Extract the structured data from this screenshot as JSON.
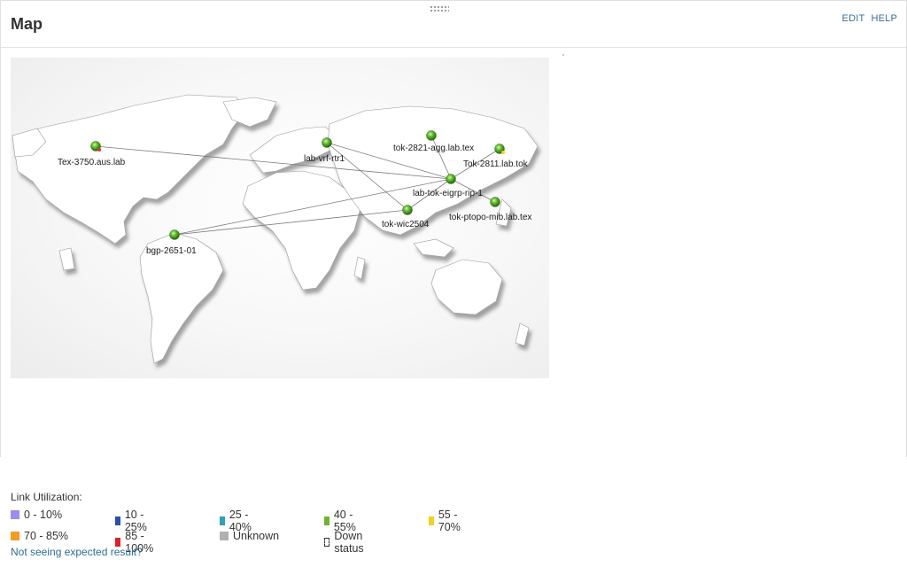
{
  "header": {
    "title": "Map",
    "edit_label": "EDIT",
    "help_label": "HELP"
  },
  "map": {
    "nodes": [
      {
        "name": "Tex-3750.aus.lab",
        "status_color": "#e8322a"
      },
      {
        "name": "lab-vrf-rtr1",
        "status_color": "#5fbf2a"
      },
      {
        "name": "tok-2821-agg.lab.tex",
        "status_color": "#5fbf2a"
      },
      {
        "name": "Tok-2811.lab.tok",
        "status_color": "#5fbf2a"
      },
      {
        "name": "lab-tok-eigrp-rip-1",
        "status_color": "#5fbf2a"
      },
      {
        "name": "tok-wic2504",
        "status_color": "#5fbf2a"
      },
      {
        "name": "tok-ptopo-mib.lab.tex",
        "status_color": "#5fbf2a"
      },
      {
        "name": "bgp-2651-01",
        "status_color": "#5fbf2a"
      }
    ]
  },
  "legend": {
    "title": "Link Utilization:",
    "items": [
      {
        "label": "0 - 10%",
        "color": "#9b8cf2"
      },
      {
        "label": "10 - 25%",
        "color": "#2b4fb8"
      },
      {
        "label": "25 - 40%",
        "color": "#2aa3b8"
      },
      {
        "label": "40 - 55%",
        "color": "#6fb52c"
      },
      {
        "label": "55 - 70%",
        "color": "#f2d21a"
      },
      {
        "label": "70 - 85%",
        "color": "#f39c1f"
      },
      {
        "label": "85 - 100%",
        "color": "#e0202a"
      },
      {
        "label": "Unknown",
        "color": "#b0b0b0"
      },
      {
        "label": "Down status",
        "color": "dashed"
      }
    ]
  },
  "help_link": "Not seeing expected result?"
}
